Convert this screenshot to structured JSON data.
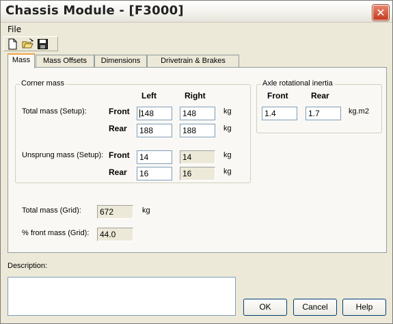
{
  "window": {
    "title": "Chassis Module - [F3000]",
    "close_glyph": "✕"
  },
  "menu": {
    "file": "File"
  },
  "toolbar": {
    "icons": [
      "new-document-icon",
      "open-folder-icon",
      "save-disk-icon"
    ]
  },
  "tabs": [
    {
      "label": "Mass",
      "active": true
    },
    {
      "label": "Mass Offsets",
      "active": false
    },
    {
      "label": "Dimensions",
      "active": false
    },
    {
      "label": "Drivetrain & Brakes",
      "active": false
    }
  ],
  "corner_mass": {
    "legend": "Corner mass",
    "col_left": "Left",
    "col_right": "Right",
    "total": {
      "label": "Total mass (Setup):",
      "front_label": "Front",
      "rear_label": "Rear",
      "front_left": "148",
      "front_right": "148",
      "rear_left": "188",
      "rear_right": "188",
      "unit": "kg"
    },
    "unsprung": {
      "label": "Unsprung mass (Setup):",
      "front_label": "Front",
      "rear_label": "Rear",
      "front_left": "14",
      "front_right": "14",
      "rear_left": "16",
      "rear_right": "16",
      "unit": "kg"
    }
  },
  "axle_inertia": {
    "legend": "Axle rotational inertia",
    "col_front": "Front",
    "col_rear": "Rear",
    "front": "1.4",
    "rear": "1.7",
    "unit": "kg.m2"
  },
  "grid": {
    "total_mass_label": "Total mass (Grid):",
    "total_mass_value": "672",
    "total_mass_unit": "kg",
    "front_pct_label": "% front mass (Grid):",
    "front_pct_value": "44.0"
  },
  "description": {
    "label": "Description:",
    "value": ""
  },
  "buttons": {
    "ok": "OK",
    "cancel": "Cancel",
    "help": "Help"
  }
}
